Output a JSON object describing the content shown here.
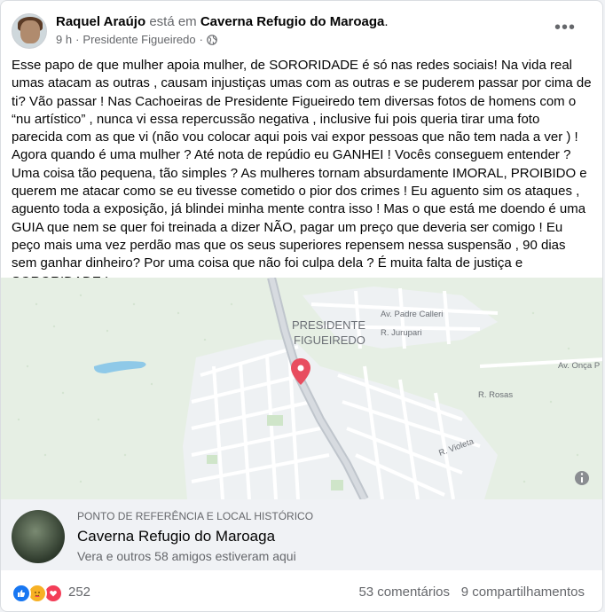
{
  "post": {
    "author": "Raquel Araújo",
    "connector": "está em",
    "place": "Caverna Refugio do Maroaga",
    "place_suffix": ".",
    "time": "9 h",
    "separator": "·",
    "location": "Presidente Figueiredo",
    "more_label": "•••",
    "body": "Esse papo de que mulher apoia mulher, de SORORIDADE é só nas redes sociais! Na vida real umas atacam as outras , causam injustiças umas com as outras e se puderem passar por cima de ti? Vão passar ! Nas Cachoeiras de Presidente Figueiredo tem diversas fotos de homens com o “nu artístico” , nunca vi essa repercussão negativa , inclusive fui pois queria tirar uma foto parecida com as que vi (não vou colocar aqui pois vai expor pessoas que não tem nada a ver ) ! Agora quando é uma mulher ? Até nota de repúdio eu GANHEI ! Vocês conseguem entender ? Uma coisa tão pequena, tão simples ? As mulheres tornam absurdamente IMORAL, PROIBIDO e querem me atacar como se eu tivesse cometido o pior dos crimes ! Eu aguento sim os ataques , aguento toda a exposição, já blindei minha mente contra isso ! Mas o que está me doendo é uma GUIA que nem se quer foi treinada a dizer NÃO, pagar um preço que deveria ser comigo ! Eu peço mais uma vez perdão mas que os seus superiores repensem nessa suspensão , 90 dias sem ganhar dinheiro? Por uma coisa que não foi culpa dela ? É muita falta de justiça e SORORIDADE !"
  },
  "map": {
    "city_line1": "PRESIDENTE",
    "city_line2": "FIGUEIREDO",
    "streets": {
      "padre_calleri": "Av. Padre Calleri",
      "jurupari": "R. Jurupari",
      "onca": "Av. Onça P",
      "rosas": "R. Rosas",
      "violeta": "R. Violeta"
    },
    "info_icon": "info-icon"
  },
  "place_card": {
    "category": "PONTO DE REFERÊNCIA E LOCAL HISTÓRICO",
    "name": "Caverna Refugio do Maroaga",
    "visitors": "Vera e outros 58 amigos estiveram aqui"
  },
  "footer": {
    "reaction_count": "252",
    "comments": "53 comentários",
    "shares": "9 compartilhamentos",
    "reactions": [
      "like-icon",
      "care-icon",
      "love-icon"
    ]
  },
  "colors": {
    "like": "#1877f2",
    "care": "#f7b125",
    "love": "#f33e58",
    "pin": "#e84d5f",
    "map_bg": "#e7efe5",
    "water": "#8fc9e8"
  }
}
